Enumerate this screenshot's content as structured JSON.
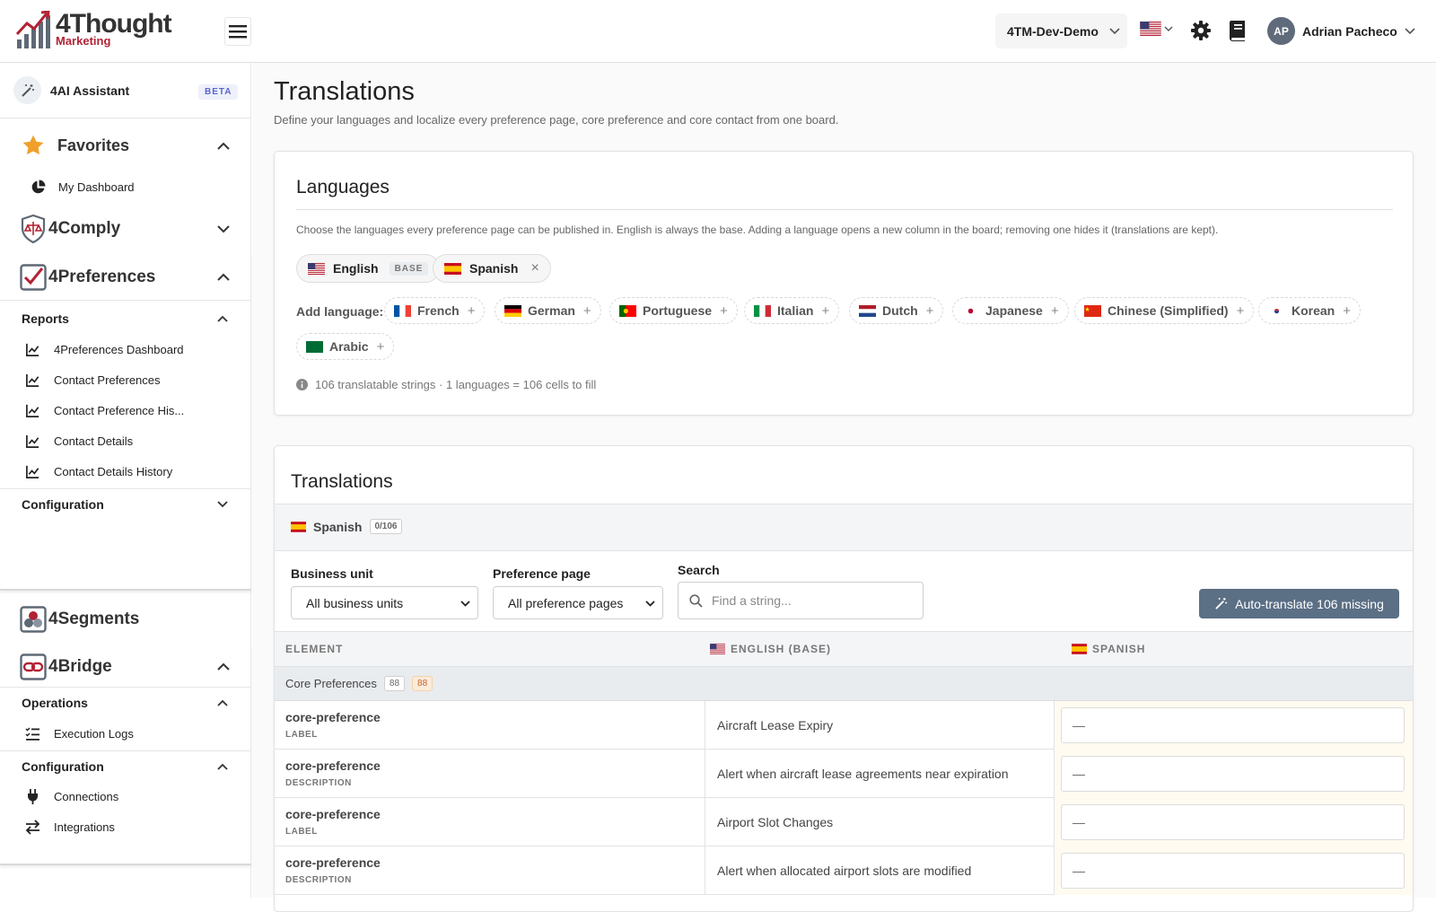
{
  "header": {
    "logo_name": "4Thought",
    "logo_sub": "Marketing",
    "tenant": "4TM-Dev-Demo",
    "user_initials": "AP",
    "user_name": "Adrian Pacheco"
  },
  "sidebar": {
    "ai_label": "4AI Assistant",
    "ai_badge": "BETA",
    "favorites": {
      "label": "Favorites",
      "items": [
        "My Dashboard"
      ]
    },
    "comply": {
      "label": "4Comply"
    },
    "preferences": {
      "label": "4Preferences",
      "reports_label": "Reports",
      "reports": [
        "4Preferences Dashboard",
        "Contact Preferences",
        "Contact Preference His...",
        "Contact Details",
        "Contact Details History"
      ],
      "config_label": "Configuration"
    },
    "segments": {
      "label": "4Segments"
    },
    "bridge": {
      "label": "4Bridge",
      "operations_label": "Operations",
      "operations": [
        "Execution Logs"
      ],
      "config_label": "Configuration",
      "config": [
        "Connections",
        "Integrations"
      ]
    }
  },
  "page": {
    "title": "Translations",
    "subtitle": "Define your languages and localize every preference page, core preference and core contact from one board."
  },
  "languages": {
    "title": "Languages",
    "description": "Choose the languages every preference page can be published in. English is always the base. Adding a language opens a new column in the board; removing one hides it (translations are kept).",
    "active": [
      {
        "name": "English",
        "tag": "BASE"
      },
      {
        "name": "Spanish",
        "remove": "×"
      }
    ],
    "add_label": "Add language:",
    "available": [
      "French",
      "German",
      "Portuguese",
      "Italian",
      "Dutch",
      "Japanese",
      "Chinese (Simplified)",
      "Korean",
      "Arabic"
    ],
    "plus": "+",
    "count_text": "106 translatable strings · 1 languages = 106 cells to fill"
  },
  "translations": {
    "title": "Translations",
    "tab": {
      "language": "Spanish",
      "progress": "0/106"
    },
    "filters": {
      "business_unit_label": "Business unit",
      "business_unit_value": "All business units",
      "preference_page_label": "Preference page",
      "preference_page_value": "All preference pages",
      "search_label": "Search",
      "search_placeholder": "Find a string..."
    },
    "auto_translate": "Auto-translate 106 missing",
    "columns": {
      "element": "ELEMENT",
      "base": "ENGLISH (BASE)",
      "target": "SPANISH"
    },
    "group": {
      "name": "Core Preferences",
      "count": "88",
      "missing": "88"
    },
    "rows": [
      {
        "element": "core-preference",
        "kind": "LABEL",
        "english": "Aircraft Lease Expiry",
        "spanish": "—"
      },
      {
        "element": "core-preference",
        "kind": "DESCRIPTION",
        "english": "Alert when aircraft lease agreements near expiration",
        "spanish": "—"
      },
      {
        "element": "core-preference",
        "kind": "LABEL",
        "english": "Airport Slot Changes",
        "spanish": "—"
      },
      {
        "element": "core-preference",
        "kind": "DESCRIPTION",
        "english": "Alert when allocated airport slots are modified",
        "spanish": "—"
      }
    ]
  },
  "colors": {
    "brand_red": "#b22234",
    "accent_button": "#5b6f85",
    "star": "#f0a02a"
  }
}
